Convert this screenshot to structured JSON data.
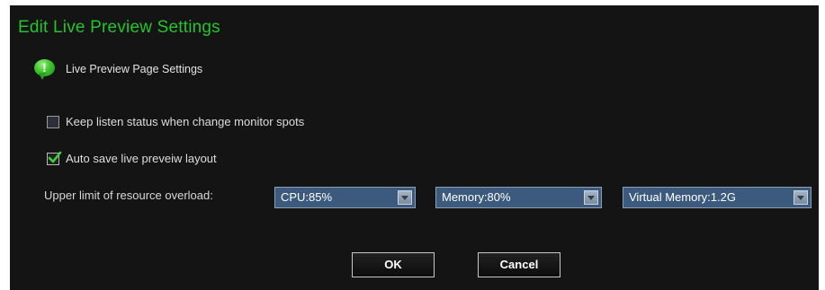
{
  "dialog": {
    "title": "Edit Live Preview Settings",
    "section_label": "Live Preview Page Settings",
    "section_icon": "info-bubble-icon"
  },
  "options": {
    "keep_listen": {
      "label": "Keep listen status when change monitor spots",
      "checked": false
    },
    "auto_save": {
      "label": "Auto save live preveiw layout",
      "checked": true
    }
  },
  "resource": {
    "label": "Upper limit of resource overload:",
    "cpu": "CPU:85%",
    "memory": "Memory:80%",
    "virtual_memory": "Virtual Memory:1.2G"
  },
  "buttons": {
    "ok": "OK",
    "cancel": "Cancel"
  },
  "colors": {
    "title": "#22c52c",
    "background": "#141414",
    "select_bg": "#3b5a7d",
    "check_mark": "#3cd23c"
  }
}
